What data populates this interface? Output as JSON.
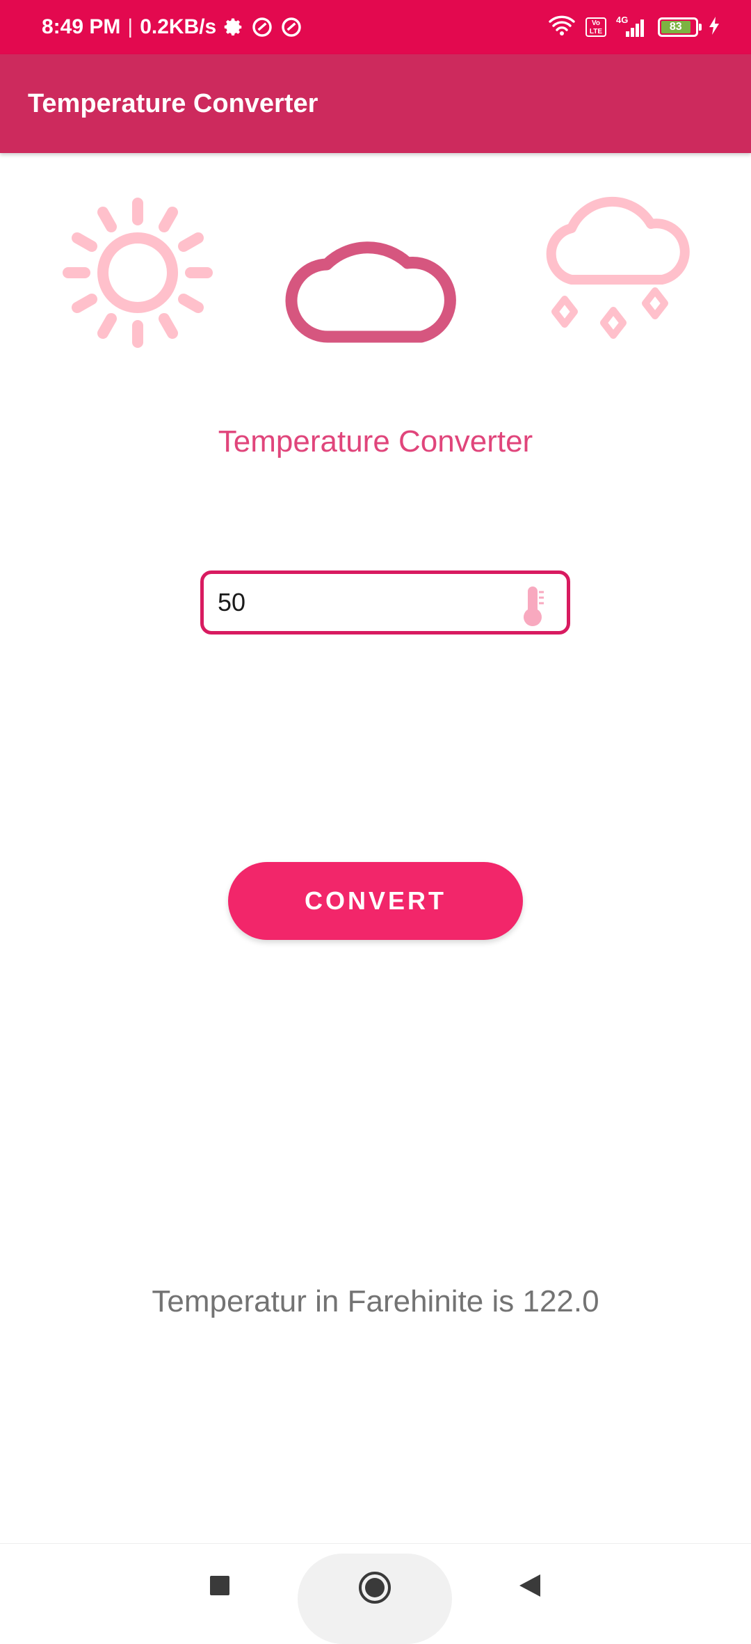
{
  "status_bar": {
    "time": "8:49 PM",
    "separator": "|",
    "speed": "0.2KB/s",
    "network": "4G",
    "volte_line1": "Vo",
    "volte_line2": "LTE",
    "battery_level": "83"
  },
  "app_bar": {
    "title": "Temperature Converter"
  },
  "weather_icons": [
    "sun-icon",
    "cloud-icon",
    "snow-cloud-icon"
  ],
  "main": {
    "heading": "Temperature Converter",
    "input_value": "50",
    "convert_label": "CONVERT",
    "result_text": "Temperatur in Farehinite is 122.0"
  },
  "colors": {
    "status_bar": "#e3094f",
    "app_bar": "#cd2a5d",
    "accent": "#f2266a",
    "heading": "#e0457b",
    "icon_faded": "#ffc0cb",
    "icon_active": "#d6567f"
  },
  "nav_bar": [
    "recents-square-icon",
    "home-circle-icon",
    "back-triangle-icon"
  ]
}
